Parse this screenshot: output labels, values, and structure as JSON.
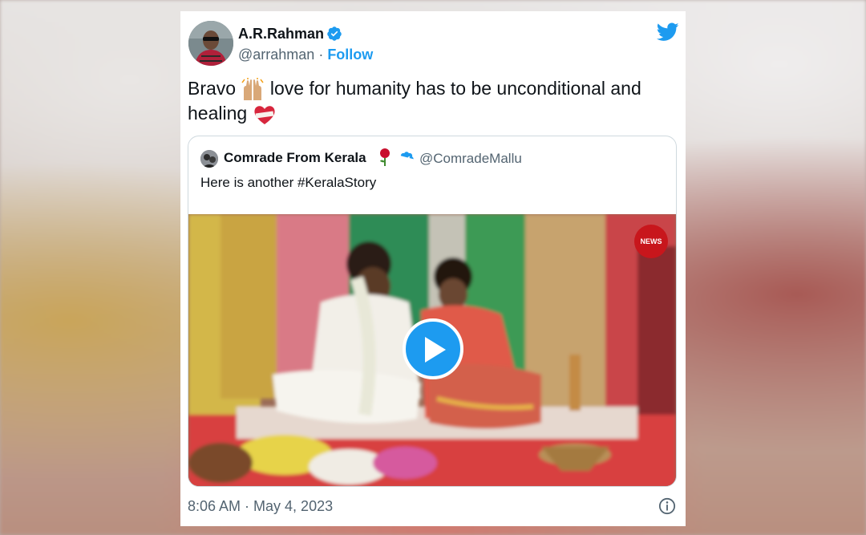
{
  "tweet": {
    "author": {
      "name": "A.R.Rahman",
      "handle": "@arrahman",
      "separator": " · ",
      "follow_label": "Follow"
    },
    "text_part1": "Bravo ",
    "text_part2": " love for humanity has to be unconditional and healing ",
    "emojis": [
      "raising-hands-emoji",
      "mending-heart-emoji"
    ],
    "timestamp": "8:06 AM · May 4, 2023"
  },
  "quoted": {
    "name": "Comrade From Kerala",
    "handle": "@ComradeMallu",
    "text": "Here is another #KeralaStory",
    "media": {
      "type": "video",
      "badge": "NEWS"
    }
  },
  "colors": {
    "accent": "#1d9bf0",
    "text": "#0f1419",
    "secondary": "#536471",
    "border": "#cfd9de"
  },
  "icons": [
    "twitter-bird-icon",
    "verified-badge-icon",
    "rose-emoji-icon",
    "play-icon",
    "info-icon"
  ]
}
